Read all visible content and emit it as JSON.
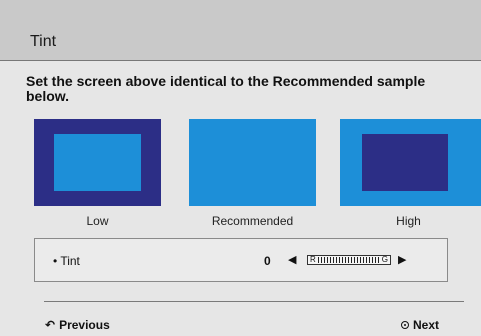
{
  "dialog": {
    "title": "Tint",
    "instruction": "Set the screen above identical to the Recommended sample\nbelow."
  },
  "samples": [
    {
      "label": "Low"
    },
    {
      "label": "Recommended"
    },
    {
      "label": "High"
    }
  ],
  "setting": {
    "label": "• Tint",
    "value": "0",
    "slider_left_end": "R",
    "slider_right_end": "G",
    "left_arrow": "◀",
    "right_arrow": "▶"
  },
  "footer": {
    "previous_label": "Previous",
    "previous_icon": "↶",
    "next_label": "Next"
  },
  "colors": {
    "dark_blue": "#2c2e86",
    "light_blue": "#1d8fd8"
  }
}
